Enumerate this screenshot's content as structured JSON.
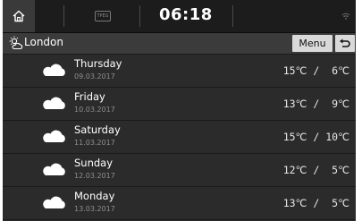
{
  "status_bar": {
    "tpeg_label": "TPEG",
    "time": "06:18"
  },
  "header": {
    "city": "London",
    "menu_label": "Menu"
  },
  "forecast": [
    {
      "day": "Thursday",
      "date": "09.03.2017",
      "temps": "15℃ /  6℃"
    },
    {
      "day": "Friday",
      "date": "10.03.2017",
      "temps": "13℃ /  9℃"
    },
    {
      "day": "Saturday",
      "date": "11.03.2017",
      "temps": "15℃ / 10℃"
    },
    {
      "day": "Sunday",
      "date": "12.03.2017",
      "temps": "12℃ /  5℃"
    },
    {
      "day": "Monday",
      "date": "13.03.2017",
      "temps": "13℃ /  5℃"
    }
  ],
  "icons": {
    "home": "home-icon",
    "signal": "signal-icon",
    "weather_city": "sun-cloud-icon",
    "back": "back-arrow-icon",
    "forecast_condition": "cloud-icon"
  },
  "colors": {
    "background": "#2b2b2b",
    "status_bar": "#1c1c1c",
    "header": "#3b3b3b",
    "button": "#d9d9d9",
    "date_text": "#8e8e8e"
  }
}
